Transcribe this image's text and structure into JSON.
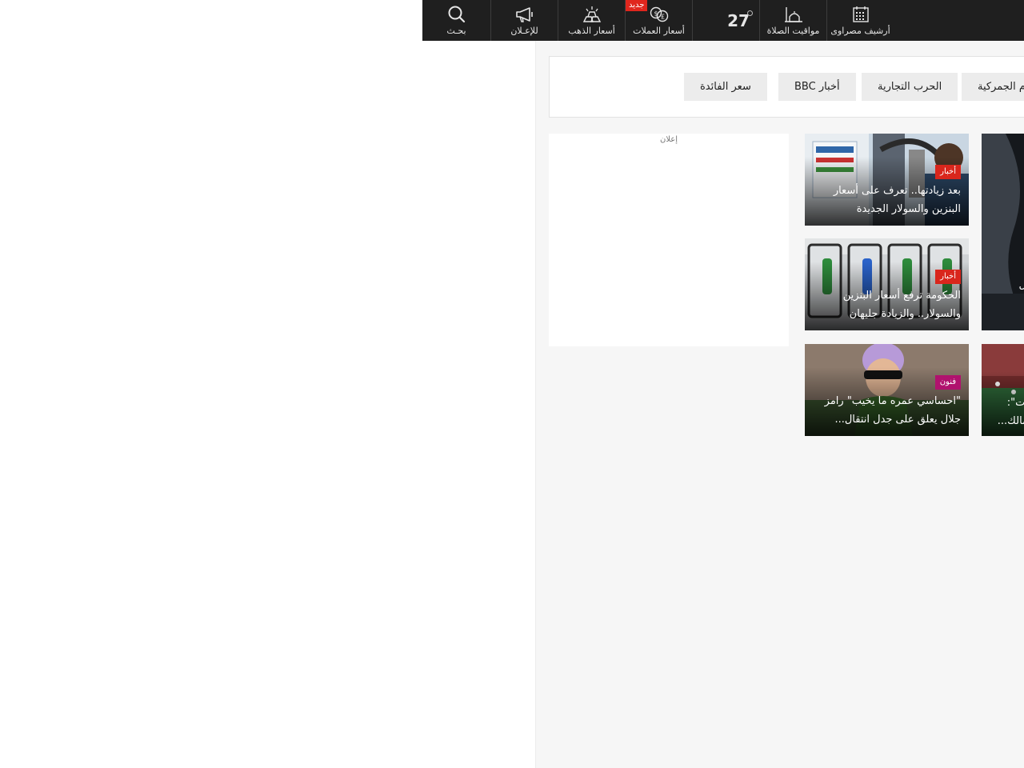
{
  "topbar": {
    "items": [
      {
        "label": "أرشيف مصراوى",
        "icon": "calendar-icon"
      },
      {
        "label": "مواقيت الصلاة",
        "icon": "mosque-icon"
      },
      {
        "label": "",
        "icon": "weather-icon"
      },
      {
        "label": "أسعار العملات",
        "icon": "currency-exchange-icon",
        "badge": "جديد"
      },
      {
        "label": "أسعار الذهب",
        "icon": "gold-bars-icon"
      },
      {
        "label": "للإعـلان",
        "icon": "megaphone-icon"
      },
      {
        "label": "بحـث",
        "icon": "search-icon"
      }
    ],
    "temperature": "27"
  },
  "tags": [
    "م الجمركية",
    "الحرب التجارية",
    "أخبار BBC",
    "سعر الفائدة"
  ],
  "ad": {
    "label": "إعلان"
  },
  "cards": [
    {
      "category": "أخبار",
      "category_color": "#d9261c",
      "line1": "بعد زيادتها.. تعرف على أسعار",
      "line2": "البنزين والسولار الجديدة"
    },
    {
      "category": "أخبار",
      "category_color": "#d9261c",
      "line1": "الحكومة ترفع أسعار البنزين",
      "line2": "والسولار.. والزيادة جليهان"
    },
    {
      "category": "فنون",
      "category_color": "#b0126e",
      "line1": "\"احساسي عمره ما يخيب\" رامز",
      "line2": "جلال يعلق على جدل انتقال..."
    }
  ],
  "partial_cards": [
    {
      "line1": "ل",
      "line2": ""
    },
    {
      "line1": "ات\":",
      "line2": "مالك..."
    }
  ]
}
